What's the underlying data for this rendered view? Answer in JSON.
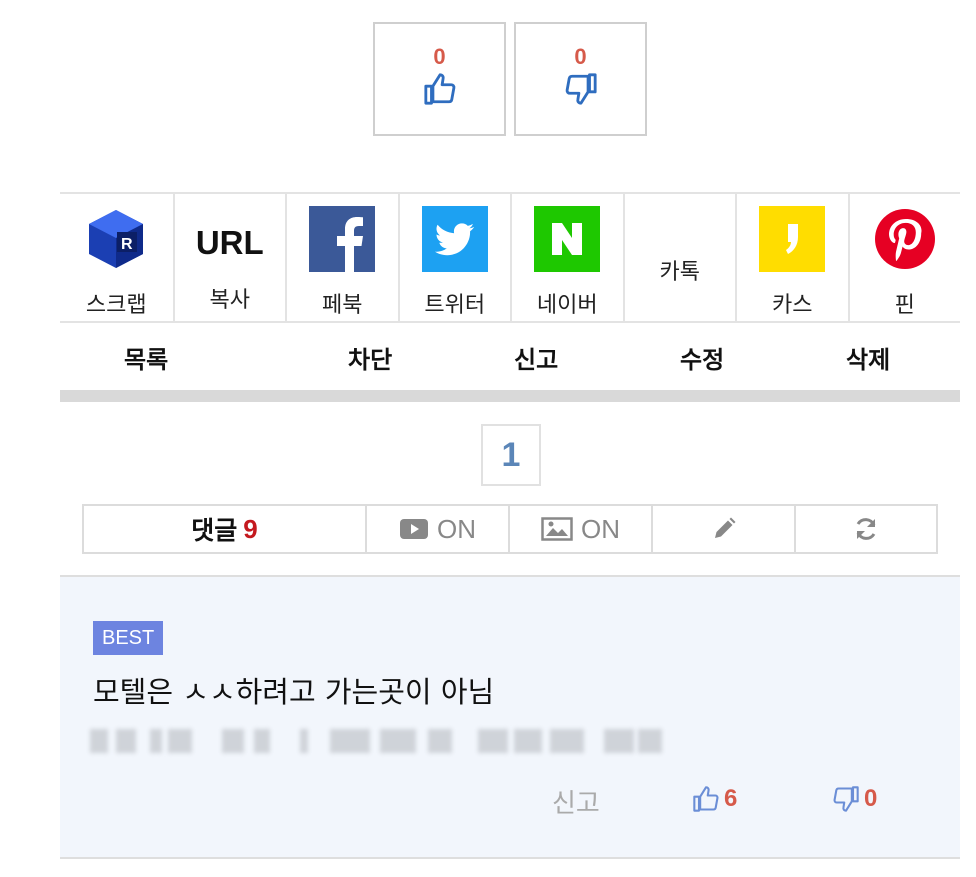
{
  "vote": {
    "up": {
      "count": "0",
      "icon": "thumbs-up-icon"
    },
    "down": {
      "count": "0",
      "icon": "thumbs-down-icon"
    }
  },
  "share": {
    "items": [
      {
        "label": "스크랩",
        "icon": "scrap-cube-icon"
      },
      {
        "label": "복사",
        "text": "URL"
      },
      {
        "label": "페북",
        "icon": "facebook-icon",
        "color": "#3b5998"
      },
      {
        "label": "트위터",
        "icon": "twitter-icon",
        "color": "#1da1f2"
      },
      {
        "label": "네이버",
        "icon": "naver-icon",
        "color": "#1ec800"
      },
      {
        "label": "카톡"
      },
      {
        "label": "카스",
        "icon": "kakaostory-icon",
        "color": "#ffd700"
      },
      {
        "label": "핀",
        "icon": "pinterest-icon",
        "color": "#e60023"
      }
    ]
  },
  "actions": {
    "list": "목록",
    "block": "차단",
    "report": "신고",
    "edit": "수정",
    "delete": "삭제"
  },
  "pagination": {
    "current": "1"
  },
  "comment_tabs": {
    "title": "댓글",
    "count": "9",
    "video_toggle": "ON",
    "image_toggle": "ON",
    "write_icon": "pencil-icon",
    "refresh_icon": "refresh-icon"
  },
  "best_comment": {
    "badge": "BEST",
    "text": "모텔은 ㅅㅅ하려고 가는곳이 아님",
    "report": "신고",
    "likes": "6",
    "dislikes": "0"
  },
  "colors": {
    "accent_red": "#d65a4a",
    "comment_count_red": "#c4191f",
    "badge_blue": "#6d84e0",
    "icon_blue": "#2f6dbf",
    "best_bg": "#f2f6fc"
  }
}
